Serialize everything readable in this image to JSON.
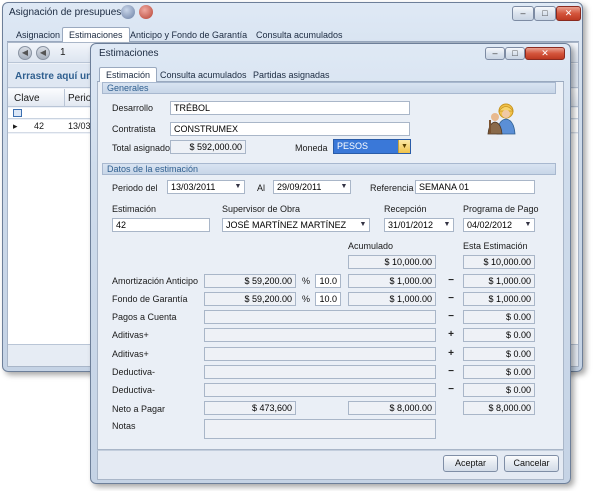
{
  "bg_window": {
    "title": "Asignación de presupuesto",
    "tabs": [
      "Asignacion",
      "Estimaciones",
      "Anticipo y Fondo de Garantía",
      "Consulta acumulados"
    ],
    "nav_value": "1",
    "group_hint": "Arrastre aquí una",
    "columns": [
      "Clave",
      "Period"
    ],
    "row": {
      "clave": "42",
      "period": "13/03/"
    }
  },
  "dialog": {
    "title": "Estimaciones",
    "tabs": [
      "Estimación",
      "Consulta acumulados",
      "Partidas asignadas"
    ],
    "generales": {
      "header": "Generales",
      "desarrollo_label": "Desarrollo",
      "desarrollo": "TRÉBOL",
      "contratista_label": "Contratista",
      "contratista": "CONSTRUMEX",
      "total_label": "Total asignado",
      "total": "$ 592,000.00",
      "moneda_label": "Moneda",
      "moneda": "PESOS"
    },
    "datos": {
      "header": "Datos de la estimación",
      "periodo_del_label": "Periodo del",
      "periodo_del": "13/03/2011",
      "al_label": "Al",
      "al": "29/09/2011",
      "referencia_label": "Referencia",
      "referencia": "SEMANA 01",
      "estimacion_label": "Estimación",
      "estimacion": "42",
      "supervisor_label": "Supervisor de Obra",
      "supervisor": "JOSÉ MARTÍNEZ MARTÍNEZ",
      "recepcion_label": "Recepción",
      "recepcion": "31/01/2012",
      "programa_label": "Programa de Pago",
      "programa": "04/02/2012",
      "acumulado_header": "Acumulado",
      "esta_header": "Esta Estimación",
      "acumulado_top": "$ 10,000.00",
      "esta_top": "$ 10,000.00"
    },
    "rows": [
      {
        "label": "Amortización Anticipo",
        "amount": "$ 59,200.00",
        "pct_sign": "%",
        "pct": "10.0",
        "acumulado": "$ 1,000.00",
        "op": "−",
        "esta": "$ 1,000.00"
      },
      {
        "label": "Fondo de Garantía",
        "amount": "$ 59,200.00",
        "pct_sign": "%",
        "pct": "10.0",
        "acumulado": "$ 1,000.00",
        "op": "−",
        "esta": "$ 1,000.00"
      },
      {
        "label": "Pagos a Cuenta",
        "amount": "",
        "acumulado": "",
        "op": "−",
        "esta": "$ 0.00"
      },
      {
        "label": "Aditivas+",
        "amount": "",
        "acumulado": "",
        "op": "+",
        "esta": "$ 0.00"
      },
      {
        "label": "Aditivas+",
        "amount": "",
        "acumulado": "",
        "op": "+",
        "esta": "$ 0.00"
      },
      {
        "label": "Deductiva-",
        "amount": "",
        "acumulado": "",
        "op": "−",
        "esta": "$ 0.00"
      },
      {
        "label": "Deductiva-",
        "amount": "",
        "acumulado": "",
        "op": "−",
        "esta": "$ 0.00"
      }
    ],
    "neto": {
      "label": "Neto a Pagar",
      "amount": "$ 473,600",
      "acumulado": "$ 8,000.00",
      "esta": "$ 8,000.00"
    },
    "notas_label": "Notas",
    "buttons": {
      "accept": "Aceptar",
      "cancel": "Cancelar"
    }
  },
  "colors": {
    "accent": "#2f5f8f",
    "selection": "#3a78d8"
  },
  "icons": [
    "back-arrow-icon",
    "forward-arrow-icon",
    "workers-icon",
    "combo-arrow-icon"
  ]
}
